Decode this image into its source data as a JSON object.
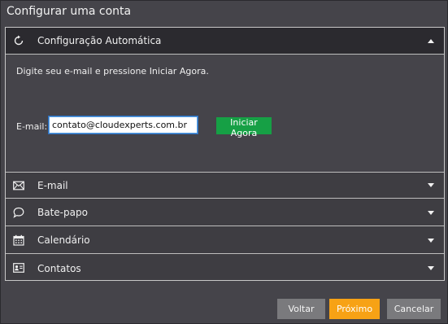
{
  "window": {
    "title": "Configurar uma conta"
  },
  "sections": {
    "auto": {
      "label": "Configuração Automática",
      "icon": "refresh-icon",
      "expanded": true,
      "hint": "Digite seu e-mail e pressione Iniciar Agora.",
      "email_label": "E-mail:",
      "email_value": "contato@cloudexperts.com.br",
      "start_label": "Iniciar Agora"
    },
    "email": {
      "label": "E-mail",
      "icon": "envelope-icon"
    },
    "chat": {
      "label": "Bate-papo",
      "icon": "chat-bubble-icon"
    },
    "calendar": {
      "label": "Calendário",
      "icon": "calendar-icon"
    },
    "contacts": {
      "label": "Contatos",
      "icon": "contact-card-icon"
    }
  },
  "footer": {
    "back_label": "Voltar",
    "next_label": "Próximo",
    "cancel_label": "Cancelar"
  },
  "colors": {
    "background": "#45444a",
    "active_header": "#2b2a2f",
    "accent_green": "#16a045",
    "accent_orange": "#f7a215",
    "neutral_button": "#7a7a7d"
  }
}
